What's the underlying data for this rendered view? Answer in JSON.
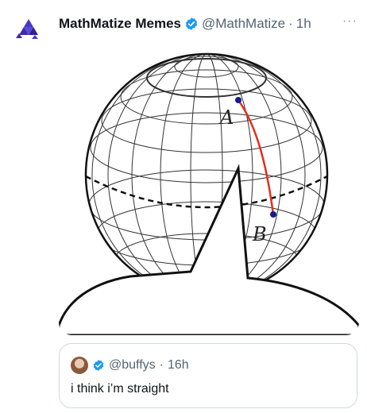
{
  "post": {
    "author_name": "MathMatize Memes",
    "handle": "@MathMatize",
    "separator": "·",
    "time": "1h",
    "more_label": "···"
  },
  "media": {
    "point_a": "A",
    "point_b": "B"
  },
  "quoted": {
    "handle": "@buffys",
    "separator": "·",
    "time": "16h",
    "text": "i think i’m straight"
  },
  "colors": {
    "verified": "#1d9bf0",
    "logo": "#3b2aa8",
    "geodesic": "#e0301e",
    "point": "#1a1a8c"
  }
}
